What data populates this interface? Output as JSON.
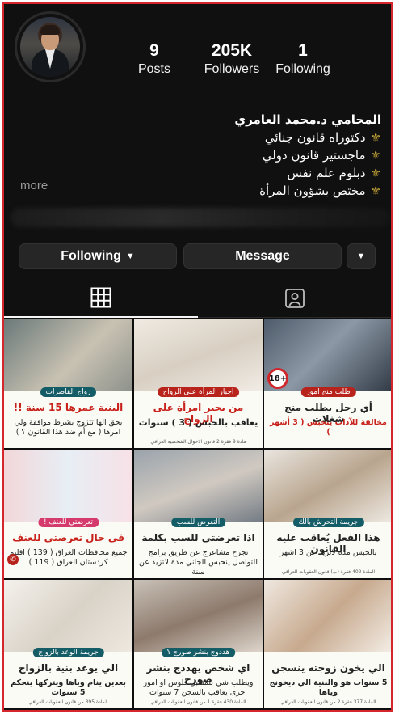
{
  "profile": {
    "posts_count": "9",
    "posts_label": "Posts",
    "followers_count": "205K",
    "followers_label": "Followers",
    "following_count": "1",
    "following_label": "Following",
    "name": "المحامي د.محمد العامري",
    "bio_lines": [
      "دكتوراه قانون جنائي",
      "ماجستير قانون دولي",
      "دبلوم علم نفس",
      "مختص بشؤون المرأة"
    ],
    "more_label": "more"
  },
  "actions": {
    "following_label": "Following",
    "message_label": "Message"
  },
  "icons": {
    "following_chevron": "chevron-down-icon",
    "suggest": "chevron-down-icon",
    "grid_tab": "grid-icon",
    "tagged_tab": "person-tag-icon",
    "bio_bullet": "fleur-de-lis-icon"
  },
  "colors": {
    "background": "#101010",
    "button": "#262626",
    "border": "#d6262d",
    "accent_red": "#c8211b",
    "tag_teal": "#155d66"
  },
  "posts": [
    {
      "tag": "زواج القاصرات",
      "head": "البنية عمرها 15 سنة !!",
      "sub": "يحق الها تتزوج بشرط موافقة ولي امرها ( مع أم ضد هذا القانون ؟ )"
    },
    {
      "tag": "اجبار المرأة على الزواج",
      "head": "من يجبر امرأة على الزواج",
      "sub": "يعاقب بالحبس ( 3 ) سنوات",
      "foot": "مادة 9 فقرة 2 قانون الاحوال الشخصية العراقي"
    },
    {
      "badge": "18+",
      "tag": "طلب منج امور",
      "head": "أي رجل يطلب منج شغلات",
      "sub": "مخالفة للآداب ينحبس ( 3 أشهر )"
    },
    {
      "tag": "تعرضتي للعنف !",
      "head": "في حال تعرضتي للعنف",
      "sub": "جميع محافظات العراق ( 139 ) اقليم كردستان العراق ( 119 )"
    },
    {
      "tag": "التعرض للسب",
      "head": "اذا تعرضتي للسب بكلمة",
      "sub": "تجرح مشاعرج عن طريق برامج التواصل ينحبس الجاني مدة لاتزيد عن سنة"
    },
    {
      "tag": "جريمة التحرش بالك",
      "head": "هذا الفعل يُعاقب عليه القانون",
      "sub": "بالحبس مدة لاتزيد عن 3 اشهر",
      "foot": "المادة 402 فقرة (ب) قانون العقوبات العراقي"
    },
    {
      "tag": "جريمة الوعد بالزواج",
      "head": "الي يوعد بنية بالزواج",
      "sub": "بعدين ينام وياها ويتركها ينحكم 5 سنوات",
      "foot": "المادة 395 من قانون العقوبات العراقي"
    },
    {
      "tag": "هددوج بنشر صورج ؟",
      "head": "اي شخص يهددج بنشر صورج",
      "sub": "ويطلب شي بلمقابل فلوس او امور اخرى يعاقب بالسجن 7 سنوات",
      "foot": "المادة 430 فقرة 1 من قانون العقوبات العراقي"
    },
    {
      "head": "الي يخون زوجته ينسجن",
      "sub": "5 سنوات هو والبنية الي ديخونج وياها",
      "foot": "المادة 377 فقرة 2 من قانون العقوبات العراقي"
    }
  ]
}
